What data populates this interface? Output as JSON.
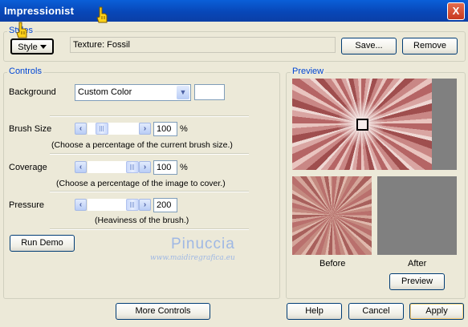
{
  "window": {
    "title": "Impressionist",
    "close_glyph": "X"
  },
  "styles": {
    "legend": "Styles",
    "style_button": "Style",
    "texture_label": "Texture: Fossil",
    "save_button": "Save...",
    "remove_button": "Remove"
  },
  "controls": {
    "legend": "Controls",
    "background": {
      "label": "Background",
      "value": "Custom Color"
    },
    "brush_size": {
      "label": "Brush Size",
      "value": "100",
      "unit": "%",
      "hint": "(Choose a percentage of the current brush size.)",
      "slider_pct": 0.2
    },
    "coverage": {
      "label": "Coverage",
      "value": "100",
      "unit": "%",
      "hint": "(Choose a percentage of the image to cover.)",
      "slider_pct": 1.0
    },
    "pressure": {
      "label": "Pressure",
      "value": "200",
      "hint": "(Heaviness of the brush.)",
      "slider_pct": 1.0
    },
    "run_demo_button": "Run Demo"
  },
  "preview": {
    "legend": "Preview",
    "before_label": "Before",
    "after_label": "After",
    "preview_button": "Preview"
  },
  "watermark": {
    "line1": "Pinuccia",
    "line2": "www.maidiregrafica.eu"
  },
  "footer": {
    "more_controls_button": "More Controls",
    "help_button": "Help",
    "cancel_button": "Cancel",
    "apply_button": "Apply"
  },
  "colors": {
    "title_blue": "#0a5fd8",
    "legend_blue": "#0046d5",
    "panel_bg": "#ece9d8",
    "after_gray": "#808080"
  }
}
